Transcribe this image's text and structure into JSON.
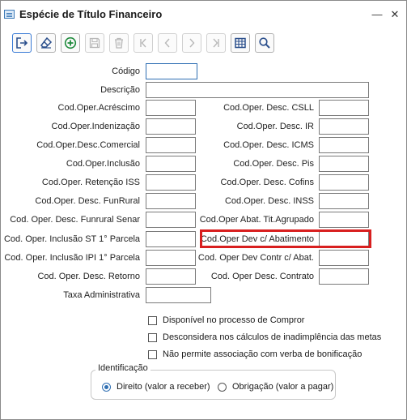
{
  "window": {
    "title": "Espécie de Título Financeiro",
    "minimize_glyph": "—",
    "close_glyph": "✕"
  },
  "toolbar": [
    {
      "name": "exit-icon",
      "state": "enabled"
    },
    {
      "name": "eraser-icon",
      "state": "enabled"
    },
    {
      "name": "add-icon",
      "state": "enabled"
    },
    {
      "name": "save-icon",
      "state": "disabled"
    },
    {
      "name": "delete-icon",
      "state": "disabled"
    },
    {
      "name": "first-record-icon",
      "state": "disabled"
    },
    {
      "name": "previous-record-icon",
      "state": "disabled"
    },
    {
      "name": "next-record-icon",
      "state": "disabled"
    },
    {
      "name": "last-record-icon",
      "state": "disabled"
    },
    {
      "name": "table-view-icon",
      "state": "enabled"
    },
    {
      "name": "search-icon",
      "state": "enabled"
    }
  ],
  "fields": {
    "codigo": {
      "label": "Código",
      "value": ""
    },
    "descricao": {
      "label": "Descrição",
      "value": ""
    },
    "acrescimo": {
      "label": "Cod.Oper.Acréscimo",
      "value": ""
    },
    "desc_csll": {
      "label": "Cod.Oper. Desc. CSLL",
      "value": ""
    },
    "indenizacao": {
      "label": "Cod.Oper.Indenização",
      "value": ""
    },
    "desc_ir": {
      "label": "Cod.Oper. Desc. IR",
      "value": ""
    },
    "desc_comercial": {
      "label": "Cod.Oper.Desc.Comercial",
      "value": ""
    },
    "desc_icms": {
      "label": "Cod.Oper. Desc. ICMS",
      "value": ""
    },
    "inclusao": {
      "label": "Cod.Oper.Inclusão",
      "value": ""
    },
    "desc_pis": {
      "label": "Cod.Oper. Desc. Pis",
      "value": ""
    },
    "retencao_iss": {
      "label": "Cod.Oper. Retenção ISS",
      "value": ""
    },
    "desc_cofins": {
      "label": "Cod.Oper. Desc. Cofins",
      "value": ""
    },
    "desc_funrural": {
      "label": "Cod.Oper. Desc. FunRural",
      "value": ""
    },
    "desc_inss": {
      "label": "Cod.Oper. Desc. INSS",
      "value": ""
    },
    "desc_funrural_senar": {
      "label": "Cod. Oper. Desc. Funrural Senar",
      "value": ""
    },
    "abat_tit_agrupado": {
      "label": "Cod.Oper Abat. Tit.Agrupado",
      "value": ""
    },
    "inclusao_st": {
      "label": "Cod. Oper. Inclusão ST 1° Parcela",
      "value": ""
    },
    "dev_abatimento": {
      "label": "Cod.Oper Dev c/ Abatimento",
      "value": ""
    },
    "inclusao_ipi": {
      "label": "Cod. Oper. Inclusão IPI 1° Parcela",
      "value": ""
    },
    "dev_contr_abat": {
      "label": "Cod. Oper Dev Contr c/ Abat.",
      "value": ""
    },
    "desc_retorno": {
      "label": "Cod. Oper. Desc. Retorno",
      "value": ""
    },
    "desc_contrato": {
      "label": "Cod. Oper Desc. Contrato",
      "value": ""
    },
    "taxa_administrativa": {
      "label": "Taxa Administrativa",
      "value": ""
    }
  },
  "checkboxes": [
    {
      "label": "Disponível no processo de Compror",
      "checked": false
    },
    {
      "label": "Desconsidera nos cálculos de inadimplência das metas",
      "checked": false
    },
    {
      "label": "Não permite associação com verba de bonificação",
      "checked": false
    }
  ],
  "identificacao": {
    "legend": "Identificação",
    "options": [
      {
        "label": "Direito (valor a receber)",
        "checked": true
      },
      {
        "label": "Obrigação (valor a pagar)",
        "checked": false
      }
    ]
  },
  "colors": {
    "highlight": "#d81f1f",
    "focus": "#2f6fb3",
    "icon_green": "#1e8a3c",
    "icon_blue": "#2b4f8c"
  }
}
